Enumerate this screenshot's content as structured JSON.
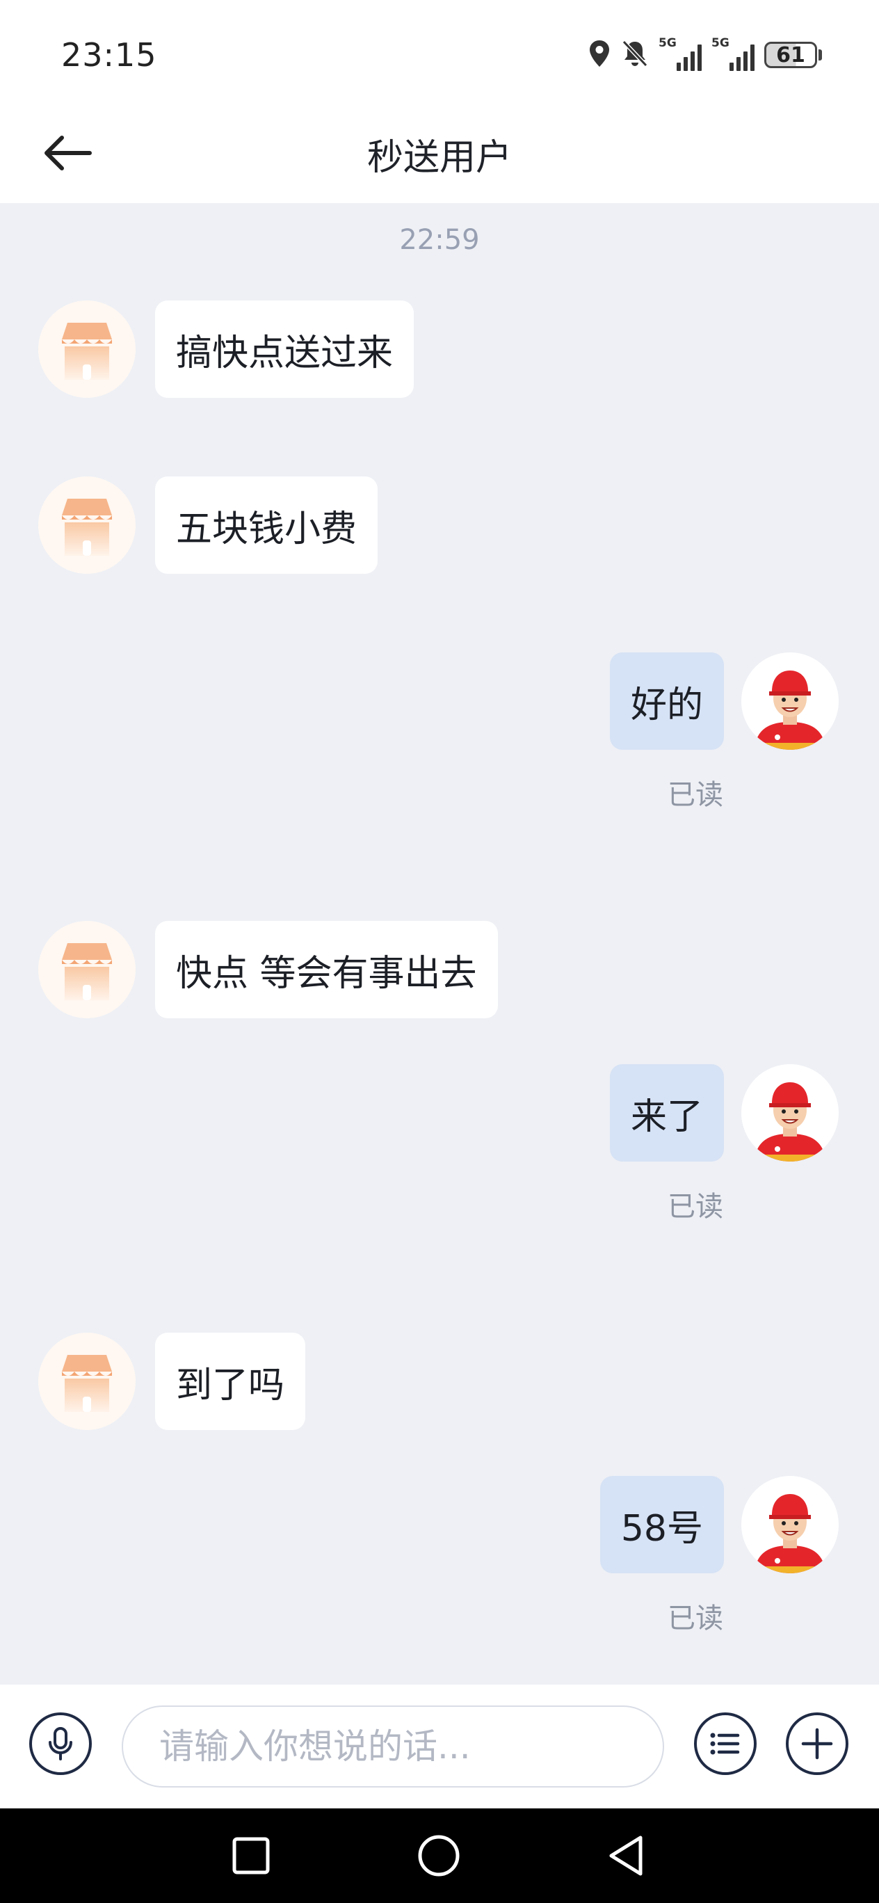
{
  "status_bar": {
    "time": "23:15",
    "network_1": "5G",
    "network_2": "5G",
    "battery_level": "61",
    "icons": [
      "location-icon",
      "bell-muted-icon",
      "signal-icon",
      "signal-icon",
      "battery-icon"
    ]
  },
  "header": {
    "title": "秒送用户",
    "back_icon": "arrow-left-icon"
  },
  "chat": {
    "timestamp": "22:59",
    "messages": [
      {
        "side": "left",
        "text": "搞快点送过来",
        "avatar": "store-avatar"
      },
      {
        "side": "left",
        "text": "五块钱小费",
        "avatar": "store-avatar"
      },
      {
        "side": "right",
        "text": "好的",
        "avatar": "courier-avatar",
        "status": "已读"
      },
      {
        "side": "left",
        "text": "快点 等会有事出去",
        "avatar": "store-avatar"
      },
      {
        "side": "right",
        "text": "来了",
        "avatar": "courier-avatar",
        "status": "已读"
      },
      {
        "side": "left",
        "text": "到了吗",
        "avatar": "store-avatar"
      },
      {
        "side": "right",
        "text": "58号",
        "avatar": "courier-avatar",
        "status": "已读"
      }
    ]
  },
  "input_bar": {
    "placeholder": "请输入你想说的话...",
    "value": "",
    "mic_icon": "microphone-icon",
    "list_icon": "list-icon",
    "plus_icon": "plus-icon"
  },
  "nav_bar": {
    "icons": [
      "recents-square-icon",
      "home-circle-icon",
      "back-triangle-icon"
    ]
  },
  "colors": {
    "chat_background": "#eef0f5",
    "outgoing_bubble": "#d6e2f5",
    "incoming_bubble": "#ffffff",
    "read_status": "#8e95a3",
    "timestamp": "#98a0b3"
  }
}
